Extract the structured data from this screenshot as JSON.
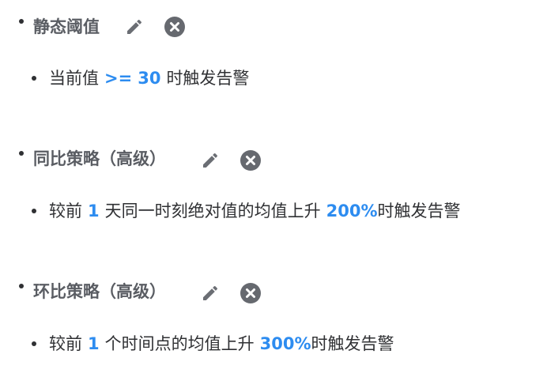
{
  "colors": {
    "text": "#2f3033",
    "title": "#5a5d63",
    "highlight": "#2d8cf0",
    "icon": "#6b6e74"
  },
  "strategies": [
    {
      "title": "静态阈值",
      "edit_icon": "pencil-icon",
      "delete_icon": "close-circle-icon",
      "rule": {
        "prefix": "当前值",
        "operator": ">=",
        "threshold": "30",
        "suffix": "时触发告警"
      }
    },
    {
      "title": "同比策略（高级）",
      "edit_icon": "pencil-icon",
      "delete_icon": "close-circle-icon",
      "rule": {
        "prefix": "较前",
        "count": "1",
        "middle": "天同一时刻绝对值的均值上升",
        "percent": "200%",
        "suffix": "时触发告警"
      }
    },
    {
      "title": "环比策略（高级）",
      "edit_icon": "pencil-icon",
      "delete_icon": "close-circle-icon",
      "rule": {
        "prefix": "较前",
        "count": "1",
        "middle": "个时间点的均值上升",
        "percent": "300%",
        "suffix": "时触发告警"
      }
    }
  ]
}
